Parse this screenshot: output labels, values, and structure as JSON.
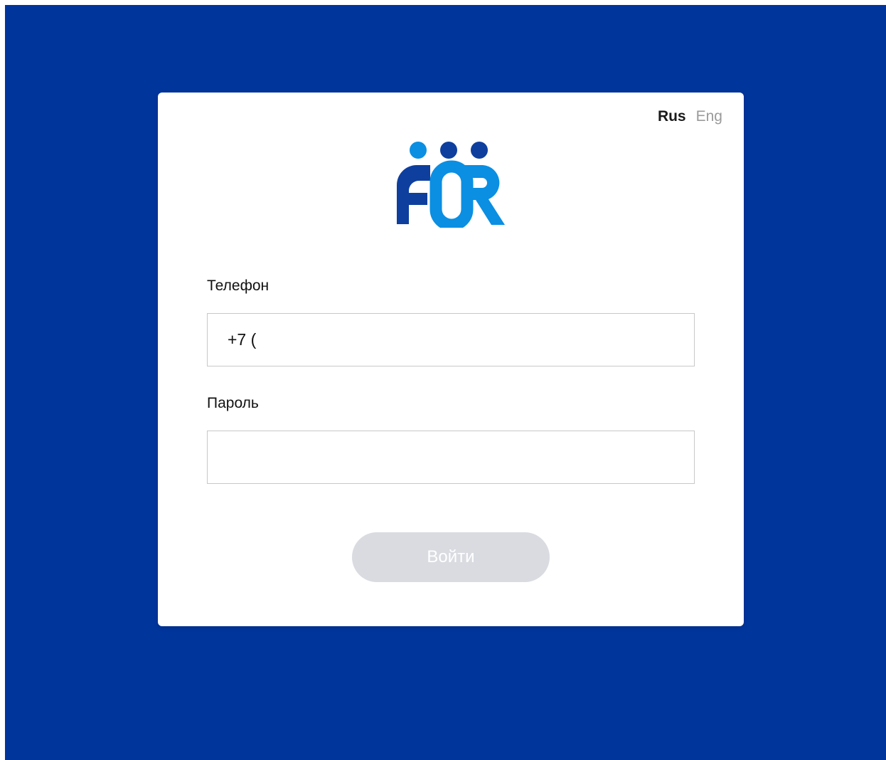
{
  "colors": {
    "background": "#00359c",
    "logo_light": "#0a8fe3",
    "logo_dark": "#0e3f9e",
    "button_disabled": "#d9dbe1"
  },
  "lang": {
    "rus": "Rus",
    "eng": "Eng",
    "selected": "Rus"
  },
  "logo": {
    "text": "FÖR"
  },
  "form": {
    "phone_label": "Телефон",
    "phone_value": "+7 (",
    "password_label": "Пароль",
    "password_value": "",
    "submit_label": "Войти"
  }
}
